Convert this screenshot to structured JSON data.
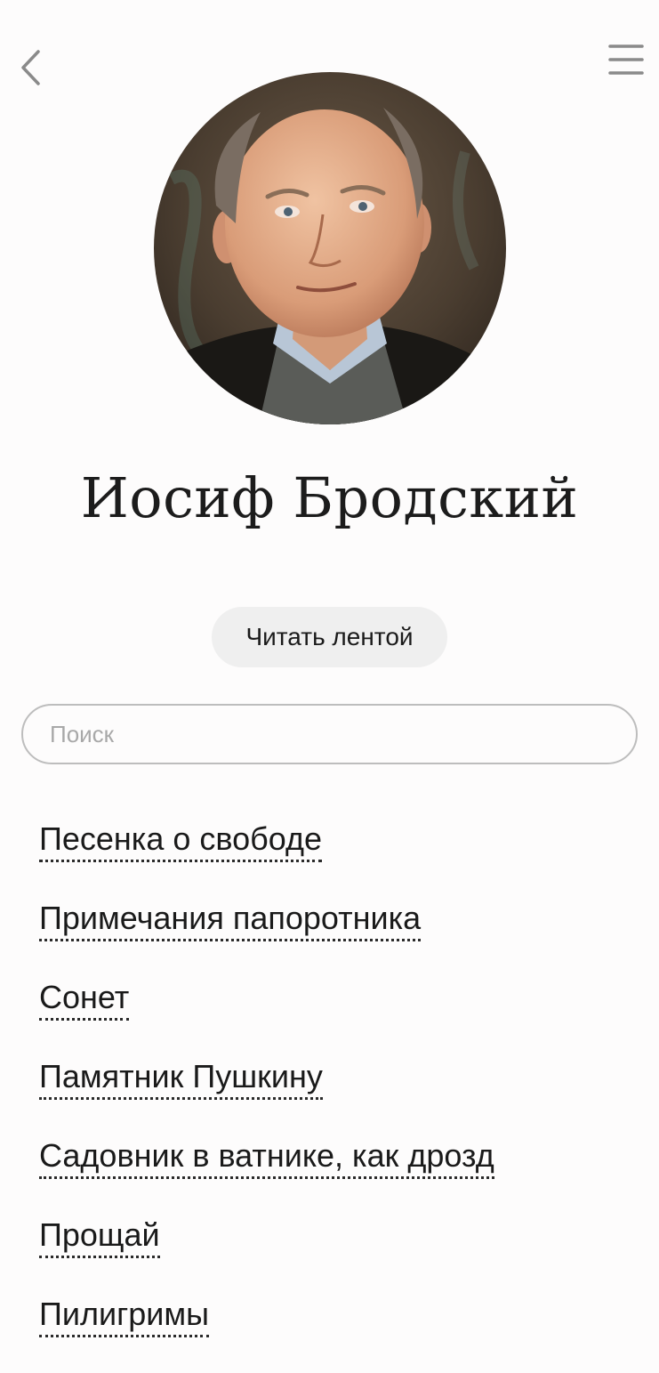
{
  "header": {
    "back_icon": "chevron-left-icon",
    "menu_icon": "hamburger-menu-icon"
  },
  "author": {
    "name": "Иосиф Бродский"
  },
  "actions": {
    "read_feed_label": "Читать лентой"
  },
  "search": {
    "placeholder": "Поиск",
    "value": ""
  },
  "poems": [
    {
      "title": "Песенка о свободе"
    },
    {
      "title": "Примечания папоротника"
    },
    {
      "title": "Сонет"
    },
    {
      "title": "Памятник Пушкину"
    },
    {
      "title": "Садовник в ватнике, как дрозд"
    },
    {
      "title": "Прощай"
    },
    {
      "title": "Пилигримы"
    }
  ],
  "colors": {
    "background": "#fdfcfc",
    "text": "#1a1a1a",
    "button_bg": "#efefef",
    "icon": "#8a8a8a",
    "input_border": "#bdbdbd",
    "placeholder": "#a8a8a8"
  }
}
